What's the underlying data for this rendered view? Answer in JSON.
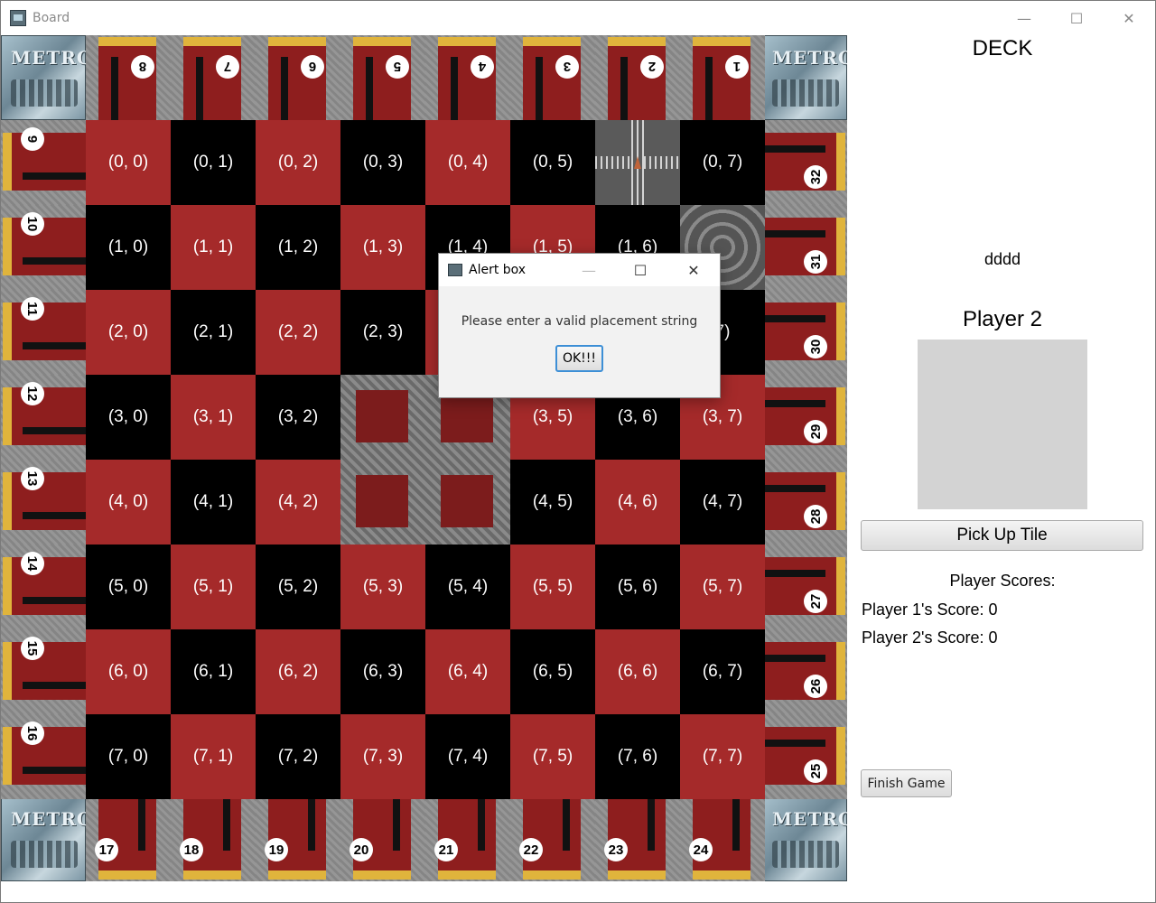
{
  "window": {
    "title": "Board",
    "controls": {
      "minimize": "—",
      "maximize": "☐",
      "close": "✕"
    }
  },
  "board": {
    "corner_logo": "METRO",
    "cell_colors": {
      "red": "#a52a2a",
      "black": "#000000"
    },
    "cells": [
      [
        {
          "label": "(0, 0)",
          "color": "red"
        },
        {
          "label": "(0, 1)",
          "color": "black"
        },
        {
          "label": "(0, 2)",
          "color": "red"
        },
        {
          "label": "(0, 3)",
          "color": "black"
        },
        {
          "label": "(0, 4)",
          "color": "red"
        },
        {
          "label": "(0, 5)",
          "color": "black"
        },
        {
          "label": "",
          "color": "tile"
        },
        {
          "label": "(0, 7)",
          "color": "black"
        }
      ],
      [
        {
          "label": "(1, 0)",
          "color": "black"
        },
        {
          "label": "(1, 1)",
          "color": "red"
        },
        {
          "label": "(1, 2)",
          "color": "black"
        },
        {
          "label": "(1, 3)",
          "color": "red"
        },
        {
          "label": "(1, 4)",
          "color": "black"
        },
        {
          "label": "(1, 5)",
          "color": "red"
        },
        {
          "label": "(1, 6)",
          "color": "black"
        },
        {
          "label": "",
          "color": "tile"
        }
      ],
      [
        {
          "label": "(2, 0)",
          "color": "red"
        },
        {
          "label": "(2, 1)",
          "color": "black"
        },
        {
          "label": "(2, 2)",
          "color": "red"
        },
        {
          "label": "(2, 3)",
          "color": "black"
        },
        {
          "label": "",
          "color": "red"
        },
        {
          "label": "",
          "color": "black"
        },
        {
          "label": "",
          "color": "red"
        },
        {
          "label": "7)",
          "color": "black"
        }
      ],
      [
        {
          "label": "(3, 0)",
          "color": "black"
        },
        {
          "label": "(3, 1)",
          "color": "red"
        },
        {
          "label": "(3, 2)",
          "color": "black"
        },
        {
          "label": "",
          "color": "centre"
        },
        {
          "label": "",
          "color": "centre"
        },
        {
          "label": "(3, 5)",
          "color": "red"
        },
        {
          "label": "(3, 6)",
          "color": "black"
        },
        {
          "label": "(3, 7)",
          "color": "red"
        }
      ],
      [
        {
          "label": "(4, 0)",
          "color": "red"
        },
        {
          "label": "(4, 1)",
          "color": "black"
        },
        {
          "label": "(4, 2)",
          "color": "red"
        },
        {
          "label": "",
          "color": "centre"
        },
        {
          "label": "",
          "color": "centre"
        },
        {
          "label": "(4, 5)",
          "color": "black"
        },
        {
          "label": "(4, 6)",
          "color": "red"
        },
        {
          "label": "(4, 7)",
          "color": "black"
        }
      ],
      [
        {
          "label": "(5, 0)",
          "color": "black"
        },
        {
          "label": "(5, 1)",
          "color": "red"
        },
        {
          "label": "(5, 2)",
          "color": "black"
        },
        {
          "label": "(5, 3)",
          "color": "red"
        },
        {
          "label": "(5, 4)",
          "color": "black"
        },
        {
          "label": "(5, 5)",
          "color": "red"
        },
        {
          "label": "(5, 6)",
          "color": "black"
        },
        {
          "label": "(5, 7)",
          "color": "red"
        }
      ],
      [
        {
          "label": "(6, 0)",
          "color": "red"
        },
        {
          "label": "(6, 1)",
          "color": "black"
        },
        {
          "label": "(6, 2)",
          "color": "red"
        },
        {
          "label": "(6, 3)",
          "color": "black"
        },
        {
          "label": "(6, 4)",
          "color": "red"
        },
        {
          "label": "(6, 5)",
          "color": "black"
        },
        {
          "label": "(6, 6)",
          "color": "red"
        },
        {
          "label": "(6, 7)",
          "color": "black"
        }
      ],
      [
        {
          "label": "(7, 0)",
          "color": "black"
        },
        {
          "label": "(7, 1)",
          "color": "red"
        },
        {
          "label": "(7, 2)",
          "color": "black"
        },
        {
          "label": "(7, 3)",
          "color": "red"
        },
        {
          "label": "(7, 4)",
          "color": "black"
        },
        {
          "label": "(7, 5)",
          "color": "red"
        },
        {
          "label": "(7, 6)",
          "color": "black"
        },
        {
          "label": "(7, 7)",
          "color": "red"
        }
      ]
    ],
    "stations": {
      "top": [
        "8",
        "7",
        "6",
        "5",
        "4",
        "3",
        "2",
        "1"
      ],
      "left": [
        "9",
        "10",
        "11",
        "12",
        "13",
        "14",
        "15",
        "16"
      ],
      "bottom": [
        "17",
        "18",
        "19",
        "20",
        "21",
        "22",
        "23",
        "24"
      ],
      "right": [
        "32",
        "31",
        "30",
        "29",
        "28",
        "27",
        "26",
        "25"
      ]
    },
    "placed_tiles": [
      {
        "row": 0,
        "col": 6,
        "type": "straight-cross-tile"
      },
      {
        "row": 1,
        "col": 7,
        "type": "curve-tile"
      }
    ]
  },
  "panel": {
    "deck_title": "DECK",
    "deck_text": "dddd",
    "player_title": "Player 2",
    "pick_up_label": "Pick Up Tile",
    "scores_title": "Player Scores:",
    "scores": [
      "Player 1's Score: 0",
      "Player 2's Score: 0"
    ],
    "finish_label": "Finish Game"
  },
  "alert": {
    "title": "Alert box",
    "message": "Please enter a valid placement string",
    "ok_label": "OK!!!",
    "controls": {
      "minimize": "—",
      "maximize": "☐",
      "close": "✕"
    }
  }
}
